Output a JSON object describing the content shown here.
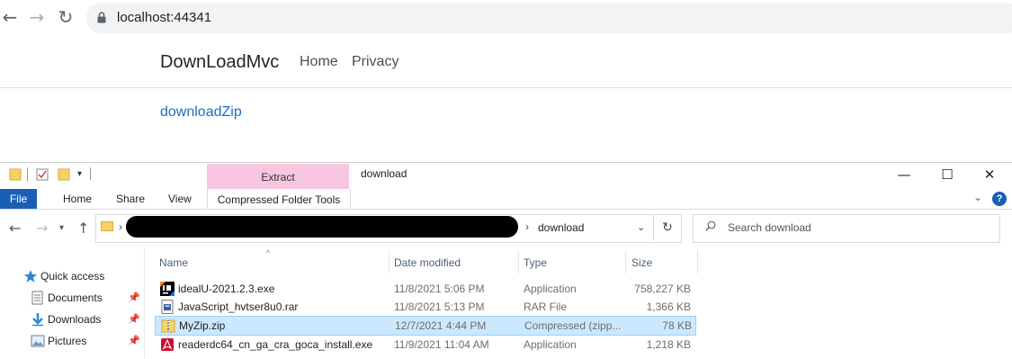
{
  "browser": {
    "url": "localhost:44341"
  },
  "site": {
    "brand": "DownLoadMvc",
    "nav": [
      "Home",
      "Privacy"
    ],
    "download_link": "downloadZip"
  },
  "explorer": {
    "context_tab": "Extract",
    "context_group": "Compressed Folder Tools",
    "title": "download",
    "ribbon_tabs": [
      "File",
      "Home",
      "Share",
      "View"
    ],
    "address_current": "download",
    "search_placeholder": "Search download",
    "nav_pane": [
      {
        "label": "Quick access",
        "icon": "star-icon"
      },
      {
        "label": "Documents",
        "icon": "documents-icon",
        "pinned": true
      },
      {
        "label": "Downloads",
        "icon": "downloads-icon",
        "pinned": true
      },
      {
        "label": "Pictures",
        "icon": "pictures-icon",
        "pinned": true
      }
    ],
    "columns": [
      "Name",
      "Date modified",
      "Type",
      "Size"
    ],
    "files": [
      {
        "name": "idealU-2021.2.3.exe",
        "date": "11/8/2021 5:06 PM",
        "type": "Application",
        "size": "758,227 KB",
        "icon": "intellij-icon"
      },
      {
        "name": "JavaScript_hvtser8u0.rar",
        "date": "11/8/2021 5:13 PM",
        "type": "RAR File",
        "size": "1,366 KB",
        "icon": "rar-icon"
      },
      {
        "name": "MyZip.zip",
        "date": "12/7/2021 4:44 PM",
        "type": "Compressed (zipp...",
        "size": "78 KB",
        "icon": "zip-folder-icon",
        "selected": true
      },
      {
        "name": "readerdc64_cn_ga_cra_goca_install.exe",
        "date": "11/9/2021 11:04 AM",
        "type": "Application",
        "size": "1,218 KB",
        "icon": "acrobat-icon"
      }
    ]
  },
  "colors": {
    "link": "#1b6ec2",
    "file_tab": "#1a5fb4",
    "extract_tab": "#f7c6e0",
    "selection": "#cce8ff"
  }
}
